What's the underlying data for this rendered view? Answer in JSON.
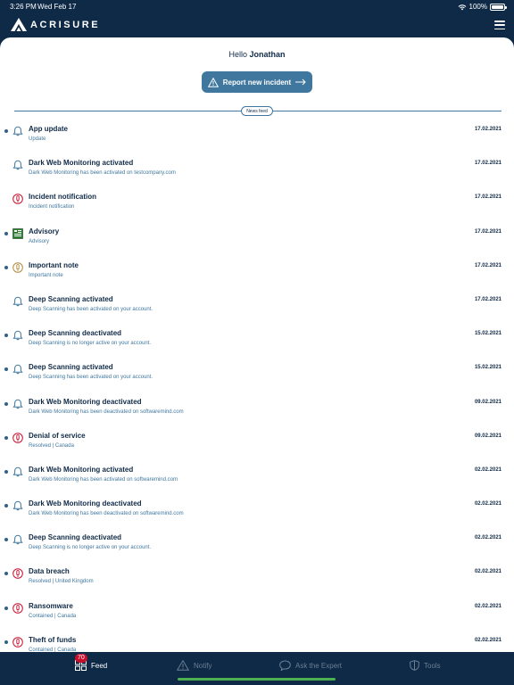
{
  "status_bar": {
    "time": "3:26 PM",
    "date": "Wed Feb 17",
    "battery": "100%"
  },
  "brand": {
    "name": "ACRISURE"
  },
  "header": {
    "greeting": "Hello",
    "user": "Jonathan",
    "report_button": "Report new incident"
  },
  "news_feed_label": "News feed",
  "colors": {
    "navy": "#0f2a47",
    "accent": "#3f779f",
    "alert_red": "#c8102e",
    "warning": "#b08a3c"
  },
  "feed": [
    {
      "title": "App update",
      "subtitle": "Update",
      "date": "17.02.2021",
      "icon": "bell-icon",
      "unread": true
    },
    {
      "title": "Dark Web Monitoring activated",
      "subtitle": "Dark Web Monitoring has been activated on testcompany.com",
      "date": "17.02.2021",
      "icon": "bell-icon",
      "unread": false
    },
    {
      "title": "Incident notification",
      "subtitle": "Incident notification",
      "date": "17.02.2021",
      "icon": "alert-icon",
      "unread": false
    },
    {
      "title": "Advisory",
      "subtitle": "Advisory",
      "date": "17.02.2021",
      "icon": "advisory-icon",
      "unread": true
    },
    {
      "title": "Important note",
      "subtitle": "Important note",
      "date": "17.02.2021",
      "icon": "important-icon",
      "unread": true
    },
    {
      "title": "Deep Scanning activated",
      "subtitle": "Deep Scanning has been activated on your account.",
      "date": "17.02.2021",
      "icon": "bell-icon",
      "unread": false
    },
    {
      "title": "Deep Scanning deactivated",
      "subtitle": "Deep Scanning is no longer active on your account.",
      "date": "15.02.2021",
      "icon": "bell-icon",
      "unread": true
    },
    {
      "title": "Deep Scanning activated",
      "subtitle": "Deep Scanning has been activated on your account.",
      "date": "15.02.2021",
      "icon": "bell-icon",
      "unread": true
    },
    {
      "title": "Dark Web Monitoring deactivated",
      "subtitle": "Dark Web Monitoring has been deactivated on softwaremind.com",
      "date": "09.02.2021",
      "icon": "bell-icon",
      "unread": true
    },
    {
      "title": "Denial of service",
      "subtitle": "Resolved | Canada",
      "date": "09.02.2021",
      "icon": "alert-icon",
      "unread": true
    },
    {
      "title": "Dark Web Monitoring activated",
      "subtitle": "Dark Web Monitoring has been activated on softwaremind.com",
      "date": "02.02.2021",
      "icon": "bell-icon",
      "unread": true
    },
    {
      "title": "Dark Web Monitoring deactivated",
      "subtitle": "Dark Web Monitoring has been deactivated on softwaremind.com",
      "date": "02.02.2021",
      "icon": "bell-icon",
      "unread": true
    },
    {
      "title": "Deep Scanning deactivated",
      "subtitle": "Deep Scanning is no longer active on your account.",
      "date": "02.02.2021",
      "icon": "bell-icon",
      "unread": true
    },
    {
      "title": "Data breach",
      "subtitle": "Resolved | United Kingdom",
      "date": "02.02.2021",
      "icon": "alert-icon",
      "unread": true
    },
    {
      "title": "Ransomware",
      "subtitle": "Contained | Canada",
      "date": "02.02.2021",
      "icon": "alert-icon",
      "unread": true
    },
    {
      "title": "Theft of funds",
      "subtitle": "Contained | Canada",
      "date": "02.02.2021",
      "icon": "alert-icon",
      "unread": true
    }
  ],
  "tabs": [
    {
      "label": "Feed",
      "icon": "feed-icon",
      "active": true,
      "badge": "70"
    },
    {
      "label": "Notify",
      "icon": "warning-icon",
      "active": false
    },
    {
      "label": "Ask the Expert",
      "icon": "chat-icon",
      "active": false
    },
    {
      "label": "Tools",
      "icon": "shield-icon",
      "active": false
    }
  ]
}
